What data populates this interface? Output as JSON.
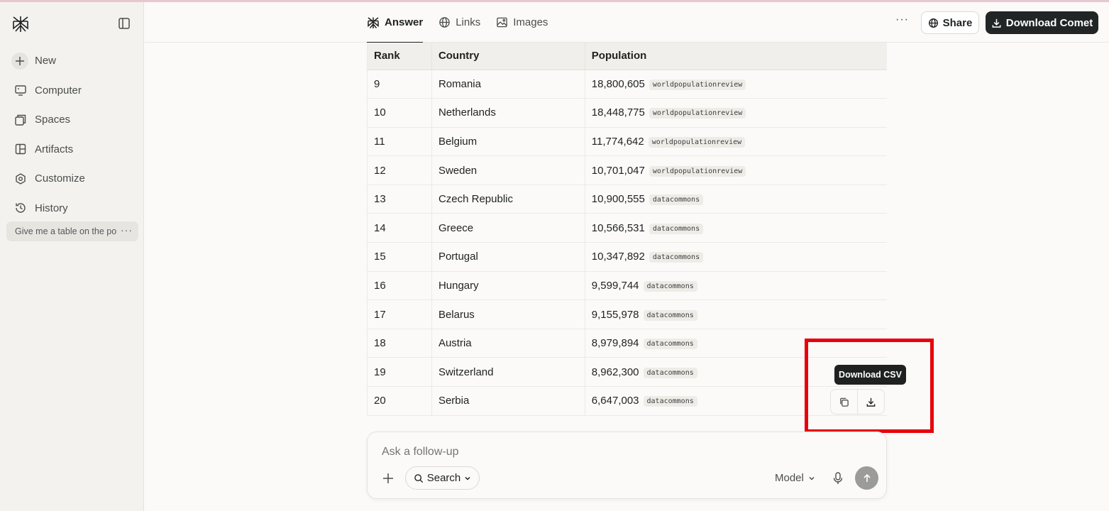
{
  "sidebar": {
    "items": [
      {
        "label": "New",
        "icon": "plus-icon"
      },
      {
        "label": "Computer",
        "icon": "computer-icon"
      },
      {
        "label": "Spaces",
        "icon": "spaces-icon"
      },
      {
        "label": "Artifacts",
        "icon": "artifacts-icon"
      },
      {
        "label": "Customize",
        "icon": "customize-icon"
      },
      {
        "label": "History",
        "icon": "history-icon"
      }
    ],
    "thread": "Give me a table on the po"
  },
  "header": {
    "tabs": [
      {
        "label": "Answer",
        "icon": "answer-icon"
      },
      {
        "label": "Links",
        "icon": "globe-icon"
      },
      {
        "label": "Images",
        "icon": "image-icon"
      }
    ],
    "more": "···",
    "share_label": "Share",
    "download_label": "Download Comet"
  },
  "table": {
    "headers": [
      "Rank",
      "Country",
      "Population"
    ],
    "rows": [
      {
        "rank": "9",
        "country": "Romania",
        "population": "18,800,605",
        "source": "worldpopulationreview"
      },
      {
        "rank": "10",
        "country": "Netherlands",
        "population": "18,448,775",
        "source": "worldpopulationreview"
      },
      {
        "rank": "11",
        "country": "Belgium",
        "population": "11,774,642",
        "source": "worldpopulationreview"
      },
      {
        "rank": "12",
        "country": "Sweden",
        "population": "10,701,047",
        "source": "worldpopulationreview"
      },
      {
        "rank": "13",
        "country": "Czech Republic",
        "population": "10,900,555",
        "source": "datacommons"
      },
      {
        "rank": "14",
        "country": "Greece",
        "population": "10,566,531",
        "source": "datacommons"
      },
      {
        "rank": "15",
        "country": "Portugal",
        "population": "10,347,892",
        "source": "datacommons"
      },
      {
        "rank": "16",
        "country": "Hungary",
        "population": "9,599,744",
        "source": "datacommons"
      },
      {
        "rank": "17",
        "country": "Belarus",
        "population": "9,155,978",
        "source": "datacommons"
      },
      {
        "rank": "18",
        "country": "Austria",
        "population": "8,979,894",
        "source": "datacommons"
      },
      {
        "rank": "19",
        "country": "Switzerland",
        "population": "8,962,300",
        "source": "datacommons"
      },
      {
        "rank": "20",
        "country": "Serbia",
        "population": "6,647,003",
        "source": "datacommons"
      }
    ]
  },
  "tooltip": "Download CSV",
  "composer": {
    "placeholder": "Ask a follow-up",
    "search_label": "Search",
    "model_label": "Model"
  },
  "colors": {
    "highlight": "#e8000b",
    "primary_button": "#222525",
    "background": "#fbfaf8"
  }
}
